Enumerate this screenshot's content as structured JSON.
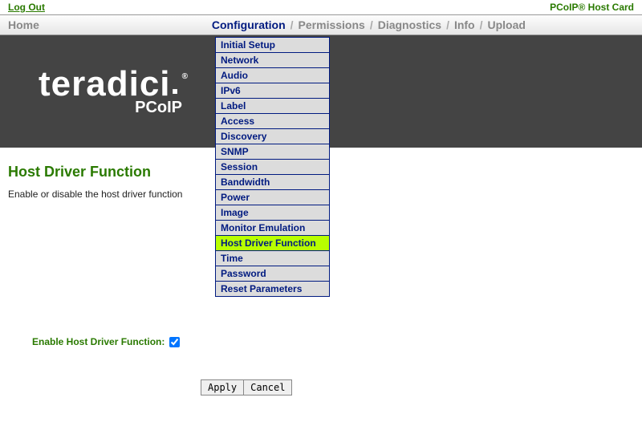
{
  "topbar": {
    "logout": "Log Out",
    "brand": "PCoIP® Host Card"
  },
  "menu": {
    "home": "Home",
    "items": [
      "Configuration",
      "Permissions",
      "Diagnostics",
      "Info",
      "Upload"
    ],
    "activeIndex": 0
  },
  "dropdown": {
    "items": [
      "Initial Setup",
      "Network",
      "Audio",
      "IPv6",
      "Label",
      "Access",
      "Discovery",
      "SNMP",
      "Session",
      "Bandwidth",
      "Power",
      "Image",
      "Monitor Emulation",
      "Host Driver Function",
      "Time",
      "Password",
      "Reset Parameters"
    ],
    "selected": "Host Driver Function"
  },
  "logo": {
    "wordmark": "teradici",
    "sub": "PCoIP"
  },
  "page": {
    "title": "Host Driver Function",
    "desc": "Enable or disable the host driver function"
  },
  "form": {
    "enable_label": "Enable Host Driver Function:",
    "enable_checked": true,
    "apply": "Apply",
    "cancel": "Cancel"
  }
}
